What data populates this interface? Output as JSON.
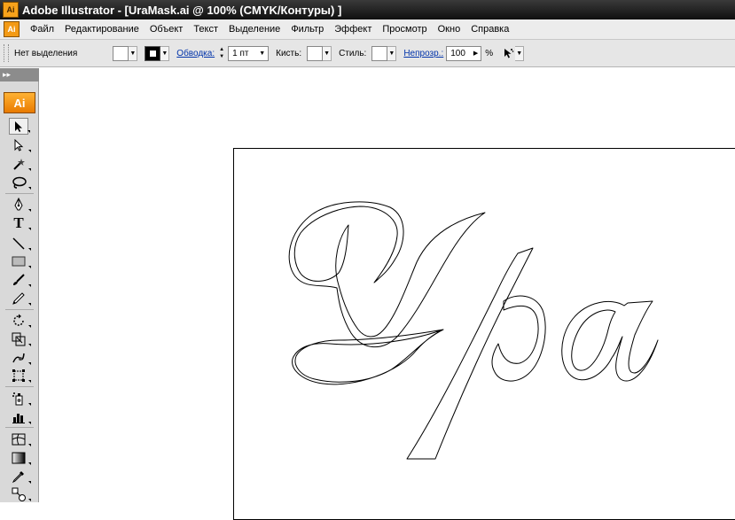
{
  "window": {
    "title": "Adobe Illustrator - [UraMask.ai @ 100% (CMYK/Контуры) ]"
  },
  "menu": {
    "items": [
      "Файл",
      "Редактирование",
      "Объект",
      "Текст",
      "Выделение",
      "Фильтр",
      "Эффект",
      "Просмотр",
      "Окно",
      "Справка"
    ]
  },
  "control": {
    "selection_label": "Нет выделения",
    "stroke_link": "Обводка:",
    "stroke_weight": "1 пт",
    "brush_label": "Кисть:",
    "style_label": "Стиль:",
    "opacity_link": "Непрозр.:",
    "opacity_value": "100",
    "opacity_unit": "%"
  },
  "tools": {
    "panel_header": "▸▸",
    "logo": "Ai",
    "selected_tool": "selection-tool"
  },
  "artwork": {
    "text": "Ура",
    "mode": "outline"
  }
}
